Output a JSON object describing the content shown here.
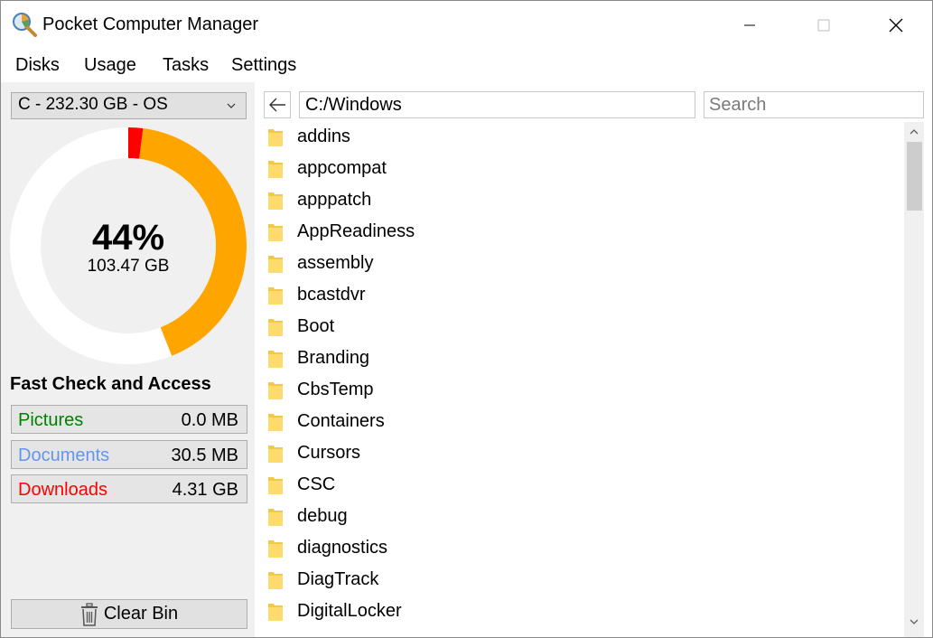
{
  "window": {
    "title": "Pocket Computer Manager",
    "controls": [
      "minimize",
      "maximize",
      "close"
    ]
  },
  "menu": [
    "Disks",
    "Usage",
    "Tasks",
    "Settings"
  ],
  "left": {
    "disk_selected": "C - 232.30 GB - OS",
    "usage_percent_label": "44%",
    "usage_percent_value": 44,
    "used_size": "103.47 GB",
    "red_segment_percent": 2,
    "colors": {
      "used": "#ffa500",
      "marker": "#ff0000",
      "free": "#ffffff"
    },
    "fast_check_title": "Fast Check and Access",
    "quick_access": [
      {
        "label": "Pictures",
        "value": "0.0 MB",
        "color": "#008000"
      },
      {
        "label": "Documents",
        "value": "30.5 MB",
        "color": "#6495ed"
      },
      {
        "label": "Downloads",
        "value": "4.31 GB",
        "color": "#ff0000"
      }
    ],
    "clear_bin": "Clear Bin"
  },
  "right": {
    "path": "C:/Windows",
    "search_placeholder": "Search",
    "folders": [
      "addins",
      "appcompat",
      "apppatch",
      "AppReadiness",
      "assembly",
      "bcastdvr",
      "Boot",
      "Branding",
      "CbsTemp",
      "Containers",
      "Cursors",
      "CSC",
      "debug",
      "diagnostics",
      "DiagTrack",
      "DigitalLocker"
    ]
  }
}
